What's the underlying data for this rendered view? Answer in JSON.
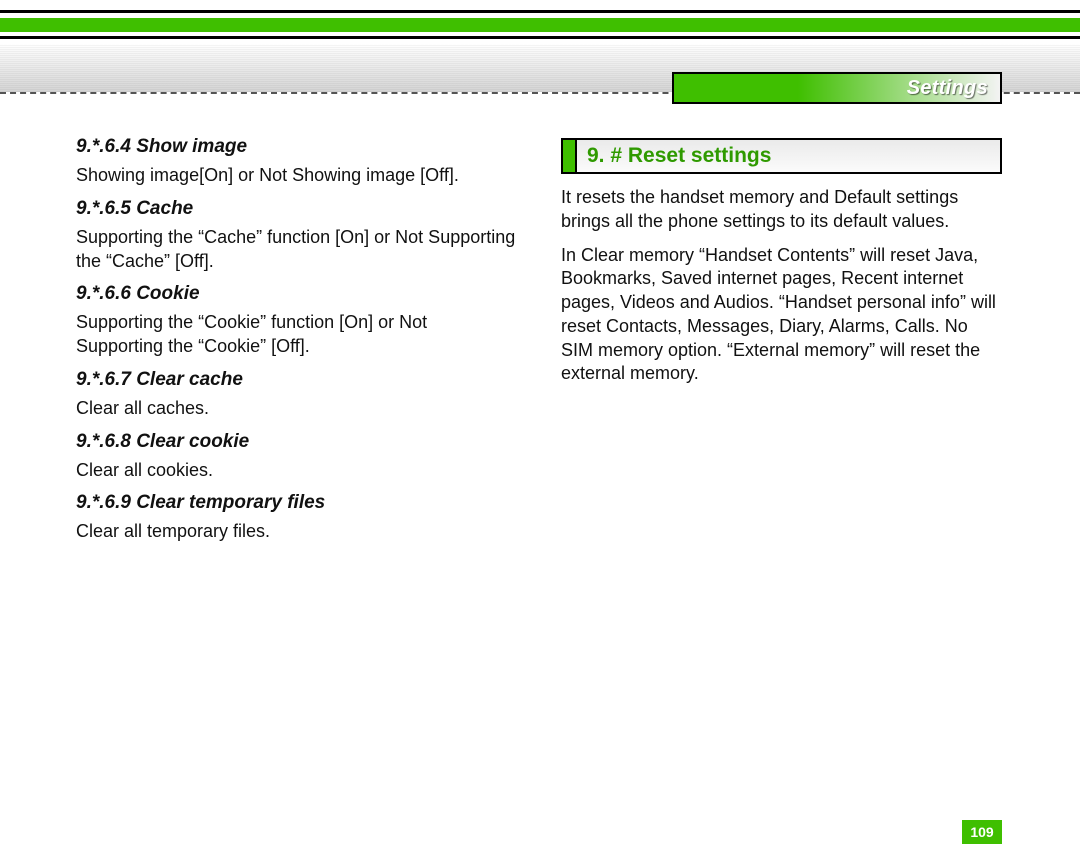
{
  "header": {
    "tab_label": "Settings"
  },
  "left": {
    "s1": {
      "head": "9.*.6.4 Show image",
      "body": "Showing image[On] or Not Showing image [Off]."
    },
    "s2": {
      "head": "9.*.6.5 Cache",
      "body": "Supporting the “Cache” function [On] or Not Supporting the “Cache” [Off]."
    },
    "s3": {
      "head": "9.*.6.6 Cookie",
      "body": "Supporting the “Cookie” function [On] or Not Supporting the “Cookie” [Off]."
    },
    "s4": {
      "head": "9.*.6.7 Clear cache",
      "body": "Clear all caches."
    },
    "s5": {
      "head": "9.*.6.8 Clear cookie",
      "body": "Clear all cookies."
    },
    "s6": {
      "head": "9.*.6.9 Clear temporary files",
      "body": "Clear all temporary files."
    }
  },
  "right": {
    "title": "9. # Reset settings",
    "p1": "It resets the handset memory and Default settings brings all the phone settings to its default values.",
    "p2": "In Clear memory “Handset Contents” will reset Java, Bookmarks, Saved internet pages, Recent internet pages, Videos and Audios. “Handset personal info” will reset Contacts, Messages, Diary, Alarms, Calls. No SIM memory option. “External memory” will reset the external memory."
  },
  "page_number": "109"
}
